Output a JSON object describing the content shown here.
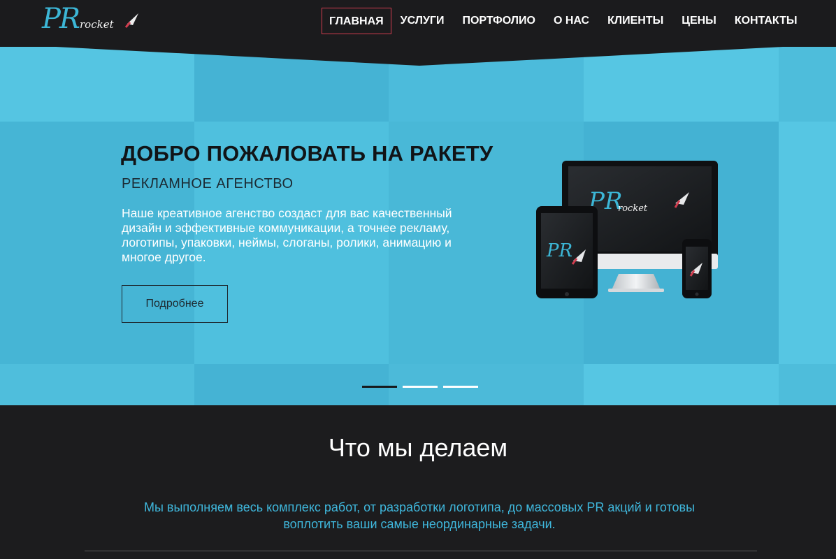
{
  "logo": {
    "pr": "PR",
    "rocket": "rocket"
  },
  "nav": {
    "items": [
      {
        "label": "ГЛАВНАЯ",
        "active": true
      },
      {
        "label": "УСЛУГИ"
      },
      {
        "label": "ПОРТФОЛИО"
      },
      {
        "label": "О НАС"
      },
      {
        "label": "КЛИЕНТЫ"
      },
      {
        "label": "ЦЕНЫ"
      },
      {
        "label": "КОНТАКТЫ"
      }
    ]
  },
  "hero": {
    "title": "ДОБРО ПОЖАЛОВАТЬ НА РАКЕТУ",
    "subtitle": "РЕКЛАМНОЕ АГЕНСТВО",
    "text": "Наше креативное агенство создаст для вас качественный дизайн и эффективные коммуникации, а точнее рекламу, логотипы, упаковки, неймы, слоганы, ролики, анимацию и многое другое.",
    "button_label": "Подробнее",
    "active_slide": 1,
    "slide_count": 3
  },
  "devices": {
    "screen_logo": "PR",
    "screen_logo_sub": "rocket"
  },
  "what": {
    "title": "Что мы делаем",
    "text": "Мы выполняем весь комплекс работ, от разработки логотипа, до массовых PR акций и готовы воплотить ваши самые неординарные задачи."
  },
  "colors": {
    "accent": "#3cb6d6",
    "hero_bg": "#56c6e3",
    "dark_bg": "#1c1c1e",
    "nav_active_border": "#d13d4f"
  }
}
